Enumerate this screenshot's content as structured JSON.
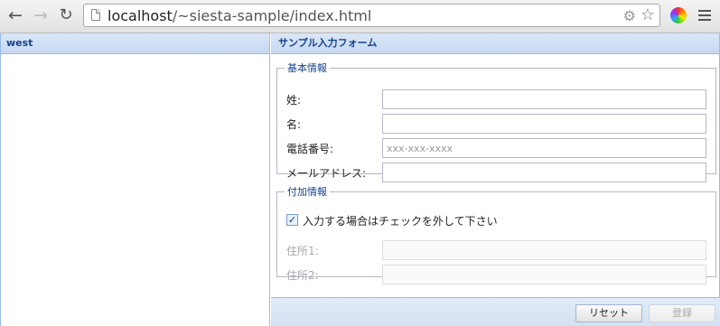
{
  "browser": {
    "url_host": "localhost",
    "url_path": "/~siesta-sample/index.html",
    "icons": [
      "back-arrow-icon",
      "forward-arrow-icon",
      "reload-icon",
      "page-icon",
      "extension-gear-icon",
      "bookmark-star-icon",
      "color-wheel-icon",
      "menu-icon"
    ]
  },
  "west": {
    "title": "west"
  },
  "form": {
    "title": "サンプル入力フォーム",
    "basic": {
      "legend": "基本情報",
      "fields": [
        {
          "label": "姓:",
          "value": "",
          "placeholder": ""
        },
        {
          "label": "名:",
          "value": "",
          "placeholder": ""
        },
        {
          "label": "電話番号:",
          "value": "",
          "placeholder": "xxx-xxx-xxxx"
        },
        {
          "label": "メールアドレス:",
          "value": "",
          "placeholder": ""
        }
      ]
    },
    "extra": {
      "legend": "付加情報",
      "checkbox_label": "入力する場合はチェックを外して下さい",
      "checkbox_checked": true,
      "fields": [
        {
          "label": "住所1:",
          "value": "",
          "placeholder": ""
        },
        {
          "label": "住所2:",
          "value": "",
          "placeholder": ""
        }
      ]
    },
    "buttons": {
      "reset": "リセット",
      "submit": "登録"
    }
  },
  "colors": {
    "header_text": "#15428b",
    "border": "#99bbe8"
  }
}
